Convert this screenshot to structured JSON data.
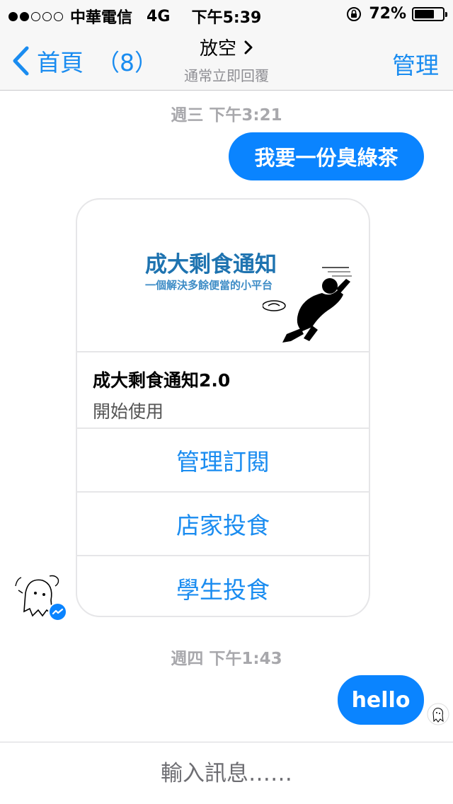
{
  "status_bar": {
    "carrier": "中華電信",
    "network": "4G",
    "time": "下午5:39",
    "battery": "72%",
    "battery_level": 0.72,
    "signal_bars": 2,
    "signal_total": 5
  },
  "nav": {
    "back_label": "首頁",
    "unread_count": "（8）",
    "title": "放空",
    "subtitle": "通常立即回覆",
    "manage_label": "管理",
    "accent_color": "#1a8cf0"
  },
  "messages": {
    "timestamp_1": "週三 下午3:21",
    "outgoing_1": "我要一份臭綠茶",
    "card": {
      "image_title": "成大剩食通知",
      "image_subtitle": "一個解決多餘便當的小平台",
      "title": "成大剩食通知2.0",
      "subtitle": "開始使用",
      "buttons": [
        "管理訂閱",
        "店家投食",
        "學生投食"
      ]
    },
    "timestamp_2": "週四 下午1:43",
    "outgoing_2": "hello"
  },
  "input": {
    "placeholder": "輸入訊息……"
  },
  "colors": {
    "bubble": "#0a84ff",
    "timestamp": "#a8a8ac"
  }
}
